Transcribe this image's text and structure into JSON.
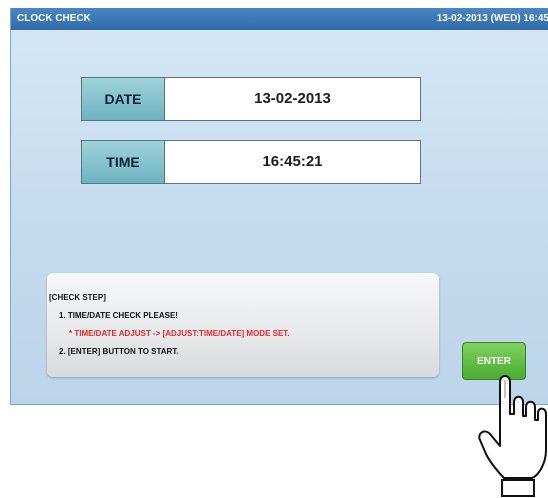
{
  "titlebar": {
    "title": "CLOCK CHECK",
    "clock": "13-02-2013 (WED) 16:45"
  },
  "fields": {
    "date": {
      "label": "DATE",
      "value": "13-02-2013"
    },
    "time": {
      "label": "TIME",
      "value": "16:45:21"
    }
  },
  "message": {
    "lines": [
      "[CHECK STEP]",
      "1. TIME/DATE CHECK PLEASE!",
      "* TIME/DATE ADJUST -> [ADJUST:TIME/DATE] MODE SET.",
      "2. [ENTER] BUTTON TO START."
    ]
  },
  "buttons": {
    "enter": "ENTER"
  },
  "icons": {
    "pointer": "hand-pointer-icon"
  },
  "colors": {
    "titlebar": "#2f6aa9",
    "screen_bg": "#c4dbee",
    "label_bg": "#6eb3c1",
    "warning_text": "#e02a2a",
    "enter_button": "#49ab2f"
  }
}
